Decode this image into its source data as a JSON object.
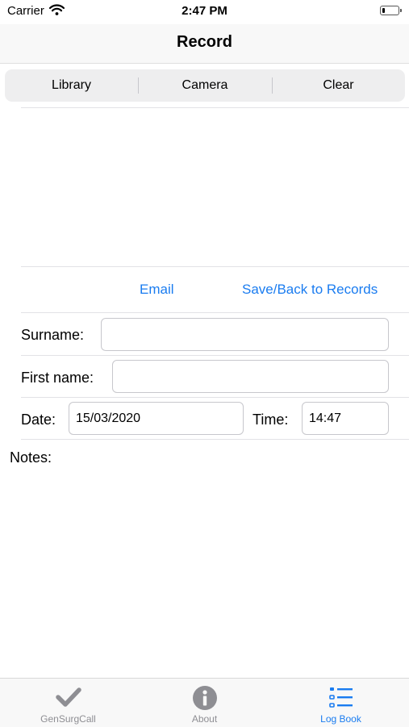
{
  "status": {
    "carrier": "Carrier",
    "time": "2:47 PM",
    "battery_level": 0.15
  },
  "nav": {
    "title": "Record"
  },
  "segments": [
    "Library",
    "Camera",
    "Clear"
  ],
  "actions": {
    "email": "Email",
    "save_back": "Save/Back to Records"
  },
  "form": {
    "surname_label": "Surname:",
    "surname_value": "",
    "firstname_label": "First name:",
    "firstname_value": "",
    "date_label": "Date:",
    "date_value": "15/03/2020",
    "time_label": "Time:",
    "time_value": "14:47",
    "notes_label": "Notes:"
  },
  "tabbar": {
    "tabs": [
      {
        "label": "GenSurgCall",
        "icon": "checkmark-icon"
      },
      {
        "label": "About",
        "icon": "info-icon"
      },
      {
        "label": "Log Book",
        "icon": "list-icon",
        "active": true
      }
    ]
  },
  "colors": {
    "accent": "#1a7cf0",
    "inactive_tab": "#8e8e93"
  }
}
